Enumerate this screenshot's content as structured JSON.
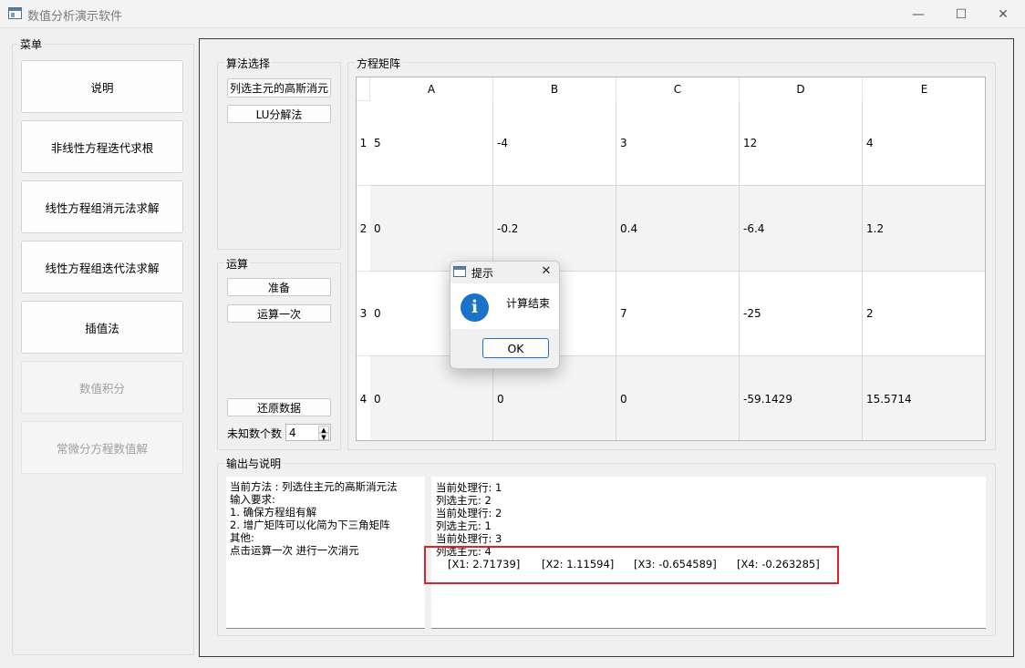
{
  "window": {
    "title": "数值分析演示软件",
    "minimize_glyph": "—",
    "maximize_glyph": "☐",
    "close_glyph": "✕"
  },
  "menu": {
    "title": "菜单",
    "items": [
      {
        "label": "说明",
        "enabled": true
      },
      {
        "label": "非线性方程迭代求根",
        "enabled": true
      },
      {
        "label": "线性方程组消元法求解",
        "enabled": true
      },
      {
        "label": "线性方程组迭代法求解",
        "enabled": true
      },
      {
        "label": "插值法",
        "enabled": true
      },
      {
        "label": "数值积分",
        "enabled": false
      },
      {
        "label": "常微分方程数值解",
        "enabled": false
      }
    ]
  },
  "algo": {
    "title": "算法选择",
    "options": [
      "列选主元的高斯消元",
      "LU分解法"
    ]
  },
  "ops": {
    "title": "运算",
    "prepare": "准备",
    "step_once": "运算一次",
    "restore": "还原数据",
    "unknowns_label": "未知数个数",
    "unknowns_value": "4"
  },
  "matrix": {
    "title": "方程矩阵",
    "columns": [
      "A",
      "B",
      "C",
      "D",
      "E"
    ],
    "row_headers": [
      "1",
      "2",
      "3",
      "4"
    ],
    "rows": [
      [
        "5",
        "-4",
        "3",
        "12",
        "4"
      ],
      [
        "0",
        "-0.2",
        "0.4",
        "-6.4",
        "1.2"
      ],
      [
        "0",
        "",
        "7",
        "-25",
        "2"
      ],
      [
        "0",
        "0",
        "0",
        "-59.1429",
        "15.5714"
      ]
    ]
  },
  "output": {
    "title": "输出与说明",
    "description": "当前方法 : 列选住主元的高斯消元法\n输入要求:\n1. 确保方程组有解\n2. 增广矩阵可以化简为下三角矩阵\n其他:\n点击运算一次 进行一次消元",
    "log_lines": [
      "当前处理行: 1",
      "列选主元: 2",
      "当前处理行: 2",
      "列选主元: 1",
      "当前处理行: 3",
      "列选主元: 4"
    ],
    "results": [
      "[X1: 2.71739]",
      "[X2: 1.11594]",
      "[X3: -0.654589]",
      "[X4: -0.263285]"
    ],
    "highlight_color": "#e0202a"
  },
  "dialog": {
    "title": "提示",
    "message": "计算结束",
    "ok_label": "OK",
    "close_glyph": "✕",
    "info_glyph": "i",
    "icon_color": "#1a73c9"
  }
}
